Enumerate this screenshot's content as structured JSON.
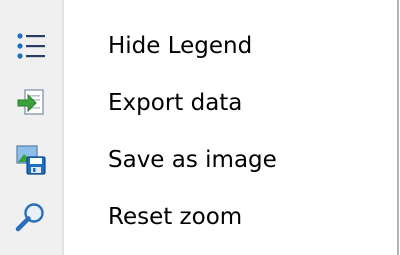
{
  "menu": {
    "items": [
      {
        "label": "Hide Legend",
        "icon": "list-icon"
      },
      {
        "label": "Export data",
        "icon": "export-icon"
      },
      {
        "label": "Save as image",
        "icon": "save-image-icon"
      },
      {
        "label": "Reset zoom",
        "icon": "magnifier-icon"
      }
    ]
  },
  "colors": {
    "icon_column": "#f0f0f0",
    "border": "#b4b4b4",
    "text": "#000000",
    "icon_blue": "#1e6fbf",
    "icon_green": "#3aa13a"
  }
}
